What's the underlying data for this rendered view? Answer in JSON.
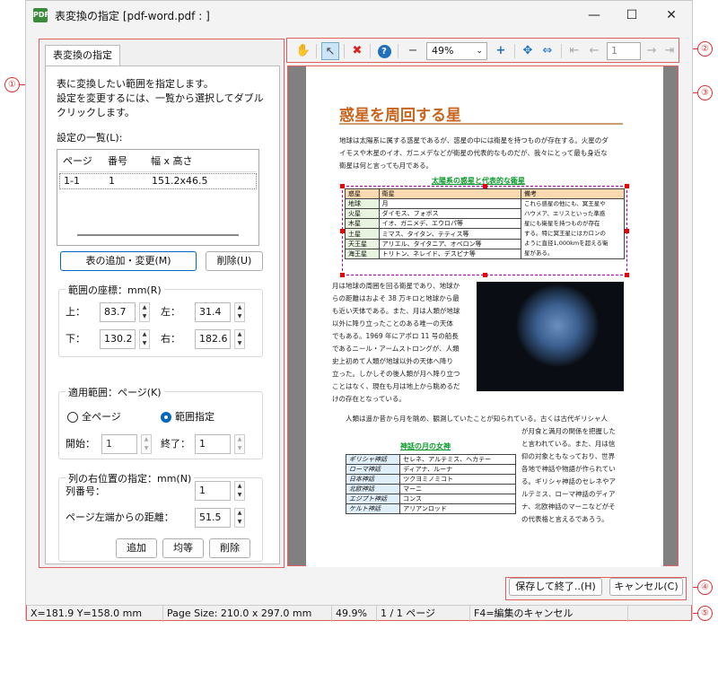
{
  "window": {
    "title": "表変換の指定 [pdf-word.pdf : ]",
    "app_icon": "PDF"
  },
  "callouts": [
    "①",
    "②",
    "③",
    "④",
    "⑤"
  ],
  "left": {
    "tab_label": "表変換の指定",
    "desc": [
      "表に変換したい範囲を指定します。",
      "設定を変更するには、一覧から選択してダブル",
      "クリックします。"
    ],
    "list_label": "設定の一覧(L):",
    "columns": [
      "ページ",
      "番号",
      "幅 x 高さ"
    ],
    "rows": [
      {
        "page": "1-1",
        "num": "1",
        "size": "151.2x46.5"
      }
    ],
    "add_btn": "表の追加・変更(M)",
    "del_btn": "削除(U)",
    "coord_label": "範囲の座標：mm(R)",
    "top_label": "上：",
    "top_val": "83.7",
    "left_label": "左：",
    "left_val": "31.4",
    "bottom_label": "下：",
    "bottom_val": "130.2",
    "right_label": "右：",
    "right_val": "182.6",
    "scope_label": "適用範囲：ページ(K)",
    "all_pages": "全ページ",
    "range_spec": "範囲指定",
    "start_label": "開始：",
    "start_val": "1",
    "end_label": "終了：",
    "end_val": "1",
    "col_label": "列の右位置の指定：mm(N)",
    "colnum_label": "列番号：",
    "colnum_val": "1",
    "dist_label": "ページ左端からの距離：",
    "dist_val": "51.5",
    "add2": "追加",
    "equal": "均等",
    "del2": "削除"
  },
  "toolbar": {
    "zoom": "49%",
    "page": "1"
  },
  "doc": {
    "title": "惑星を周回する星",
    "p1": [
      "地球は太陽系に属する惑星であるが、惑星の中には衛星を持つものが存在する。火星のダ",
      "イモスや木星のイオ、ガニメデなどが衛星の代表的なものだが、我々にとって最も身近な",
      "衛星は何と言っても月である。"
    ],
    "t1_title": "太陽系の惑星と代表的な衛星",
    "t1_head": [
      "惑星",
      "衛星",
      "備考"
    ],
    "t1_rows": [
      [
        "地球",
        "月"
      ],
      [
        "火星",
        "ダイモス、フォボス"
      ],
      [
        "木星",
        "イオ、ガニメデ、エウロパ等"
      ],
      [
        "土星",
        "ミマス、タイタン、テティス等"
      ],
      [
        "天王星",
        "アリエル、タイタニア、オベロン等"
      ],
      [
        "海王星",
        "トリトン、ネレイド、デスピナ等"
      ]
    ],
    "t1_note": [
      "これら惑星の他にも、冥王星や",
      "ハウメア、エリスといった準惑",
      "星にも衛星を持つものが存在",
      "する。特に冥王星にはカロンの",
      "ように直径1,000kmを超える衛",
      "星がある。"
    ],
    "p2": [
      "月は地球の周囲を回る衛星であり、地球か",
      "らの距離はおよそ 38 万キロと地球から最",
      "も近い天体である。また、月は人類が地球",
      "以外に降り立ったことのある唯一の天体",
      "でもある。1969 年にアポロ 11 号の船長",
      "であるニール・アームストロングが、人類",
      "史上初めて人類が地球以外の天体へ降り",
      "立った。しかしその後人類が月へ降り立つ",
      "ことはなく、現在も月は地上から眺めるだ",
      "けの存在となっている。"
    ],
    "p3": "人類は遥か昔から月を眺め、観測していたことが知られている。古くは古代ギリシャ人",
    "p3b": [
      "が月食と満月の関係を把握した",
      "と言われている。また、月は信",
      "仰の対象ともなっており、世界",
      "各地で神話や物語が作られてい",
      "る。ギリシャ神話のセレネやア",
      "ルテミス、ローマ神話のディア",
      "ナ、北欧神話のマーニなどがそ",
      "の代表格と言えるであろう。"
    ],
    "t2_title": "神話の月の女神",
    "t2_rows": [
      [
        "ギリシャ神話",
        "セレネ、アルテミス、ヘカテー"
      ],
      [
        "ローマ神話",
        "ディアナ、ルーナ"
      ],
      [
        "日本神話",
        "ツクヨミノミコト"
      ],
      [
        "北欧神話",
        "マーニ"
      ],
      [
        "エジプト神話",
        "コンス"
      ],
      [
        "ケルト神話",
        "アリアンロッド"
      ]
    ]
  },
  "buttons": {
    "save": "保存して終了..(H)",
    "cancel": "キャンセル(C)"
  },
  "status": {
    "coords": "X=181.9 Y=158.0 mm",
    "page_size": "Page Size: 210.0 x 297.0 mm",
    "zoom": "49.9%",
    "pages": "1 / 1 ページ",
    "hint": "F4=編集のキャンセル"
  }
}
